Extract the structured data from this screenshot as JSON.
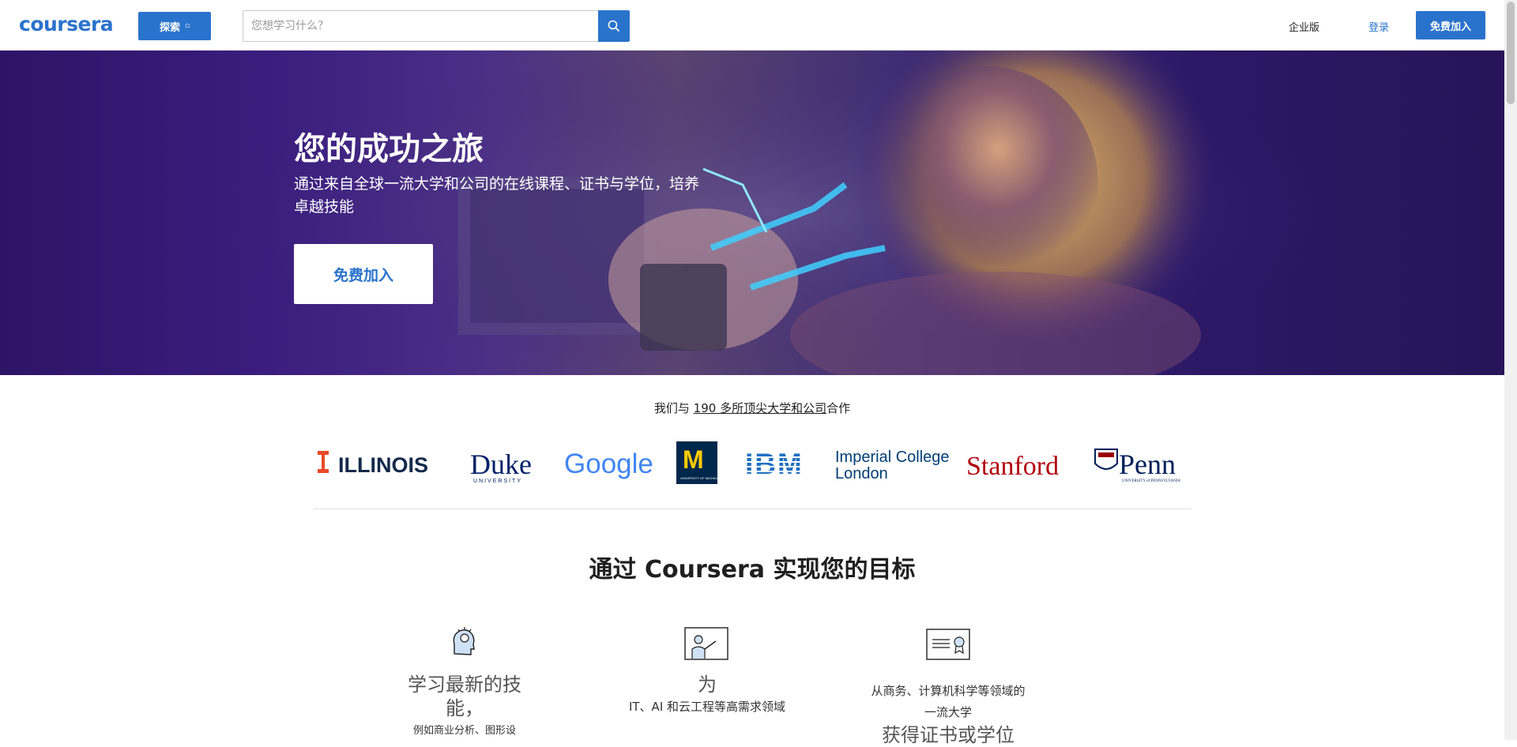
{
  "header": {
    "logo": "coursera",
    "explore_label": "探索",
    "explore_caret": "▫",
    "search_placeholder": "您想学习什么？",
    "enterprise": "企业版",
    "login": "登录",
    "join": "免费加入"
  },
  "hero": {
    "title": "您的成功之旅",
    "subtitle": "通过来自全球一流大学和公司的在线课程、证书与学位，培养卓越技能",
    "cta": "免费加入"
  },
  "partners": {
    "prefix": "我们与 ",
    "link": "190 多所顶尖大学和公司",
    "suffix": "合作",
    "logos": [
      "ILLINOIS",
      "Duke",
      "UNIVERSITY",
      "Google",
      "M",
      "UNIVERSITY OF MICHIGAN",
      "IBM",
      "Imperial College",
      "London",
      "Stanford",
      "Penn",
      "UNIVERSITY of PENNSYLVANIA"
    ]
  },
  "goals": {
    "title": "通过 Coursera 实现您的目标",
    "features": [
      {
        "big": "学习最新的技能，",
        "small": "例如商业分析、图形设"
      },
      {
        "big": "为",
        "small": "IT、AI 和云工程等高需求领域"
      },
      {
        "small": "从商务、计算机科学等领域的一流大学",
        "big": "获得证书或学位"
      }
    ]
  },
  "colors": {
    "brand": "#2a73cc",
    "hero_bg": "#2e1467"
  }
}
